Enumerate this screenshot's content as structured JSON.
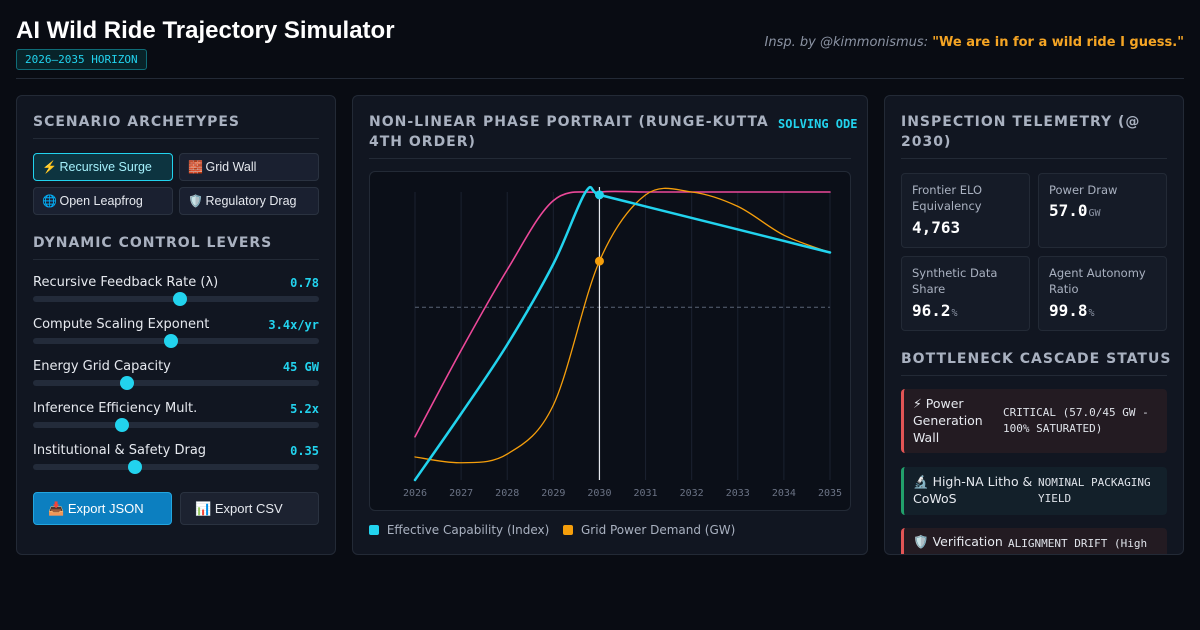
{
  "header": {
    "title": "AI Wild Ride Trajectory Simulator",
    "horizon_badge": "2026–2035 HORIZON",
    "inspiration_credit": "Insp. by @kimmonismus:",
    "inspiration_quote": "\"We are in for a wild ride I guess.\""
  },
  "scenarios": {
    "title": "SCENARIO ARCHETYPES",
    "items": [
      {
        "icon": "⚡",
        "icon_name": "lightning-icon",
        "label": "Recursive Surge",
        "active": true
      },
      {
        "icon": "🧱",
        "icon_name": "brick-wall-icon",
        "label": "Grid Wall",
        "active": false
      },
      {
        "icon": "🌐",
        "icon_name": "globe-icon",
        "label": "Open Leapfrog",
        "active": false
      },
      {
        "icon": "🛡️",
        "icon_name": "shield-icon",
        "label": "Regulatory Drag",
        "active": false
      }
    ]
  },
  "levers": {
    "title": "DYNAMIC CONTROL LEVERS",
    "items": [
      {
        "label": "Recursive Feedback Rate (λ)",
        "value": "0.78",
        "level": 0.515
      },
      {
        "label": "Compute Scaling Exponent",
        "value": "3.4x/yr",
        "level": 0.482
      },
      {
        "label": "Energy Grid Capacity",
        "value": "45 GW",
        "level": 0.329
      },
      {
        "label": "Inference Efficiency Mult.",
        "value": "5.2x",
        "level": 0.311
      },
      {
        "label": "Institutional & Safety Drag",
        "value": "0.35",
        "level": 0.357
      }
    ]
  },
  "actions": {
    "export_json": {
      "icon": "📥",
      "icon_name": "download-tray-icon",
      "label": "Export JSON"
    },
    "export_csv": {
      "icon": "📊",
      "icon_name": "bar-chart-icon",
      "label": "Export CSV"
    }
  },
  "portrait": {
    "title": "NON-LINEAR PHASE PORTRAIT (RUNGE-KUTTA 4TH ORDER)",
    "badge": "SOLVING ODE"
  },
  "chart_data": {
    "type": "line",
    "title": "",
    "xlabel": "",
    "ylabel": "",
    "x": [
      2026,
      2027,
      2028,
      2029,
      2030,
      2031,
      2032,
      2033,
      2034,
      2035
    ],
    "ylim": [
      0,
      100
    ],
    "grid": "vertical",
    "marker_year": 2030,
    "threshold": 60,
    "legend_position": "bottom",
    "series": [
      {
        "name": "Effective Capability (Index)",
        "color": "#22d3ee",
        "values": [
          0,
          23,
          47,
          75,
          99,
          95,
          91,
          87,
          83,
          79
        ],
        "peak": [
          2029.7,
          100
        ]
      },
      {
        "name": "Grid Power Demand (GW)",
        "color": "#f59e0b",
        "values": [
          8,
          6,
          9,
          26,
          76,
          99,
          100,
          95,
          85,
          79
        ]
      },
      {
        "name": "",
        "color": "#ec4899",
        "values": [
          15,
          45,
          73,
          97,
          100,
          100,
          100,
          100,
          100,
          100
        ]
      }
    ]
  },
  "telemetry": {
    "title": "INSPECTION TELEMETRY (@ 2030)",
    "metrics": [
      {
        "label": "Frontier ELO Equivalency",
        "value": "4,763",
        "unit": ""
      },
      {
        "label": "Power Draw",
        "value": "57.0",
        "unit": "GW"
      },
      {
        "label": "Synthetic Data Share",
        "value": "96.2",
        "unit": "%"
      },
      {
        "label": "Agent Autonomy Ratio",
        "value": "99.8",
        "unit": "%"
      }
    ]
  },
  "bottlenecks": {
    "title": "BOTTLENECK CASCADE STATUS",
    "items": [
      {
        "icon": "⚡",
        "icon_name": "lightning-icon",
        "name": "Power Generation Wall",
        "status": "CRITICAL (57.0/45 GW - 100% SATURATED)",
        "severity": "critical"
      },
      {
        "icon": "🔬",
        "icon_name": "microscope-icon",
        "name": "High-NA Litho & CoWoS",
        "status": "NOMINAL PACKAGING YIELD",
        "severity": "nominal"
      },
      {
        "icon": "🛡️",
        "icon_name": "shield-icon",
        "name": "Verification",
        "status": "ALIGNMENT DRIFT (High",
        "severity": "critical"
      }
    ]
  }
}
